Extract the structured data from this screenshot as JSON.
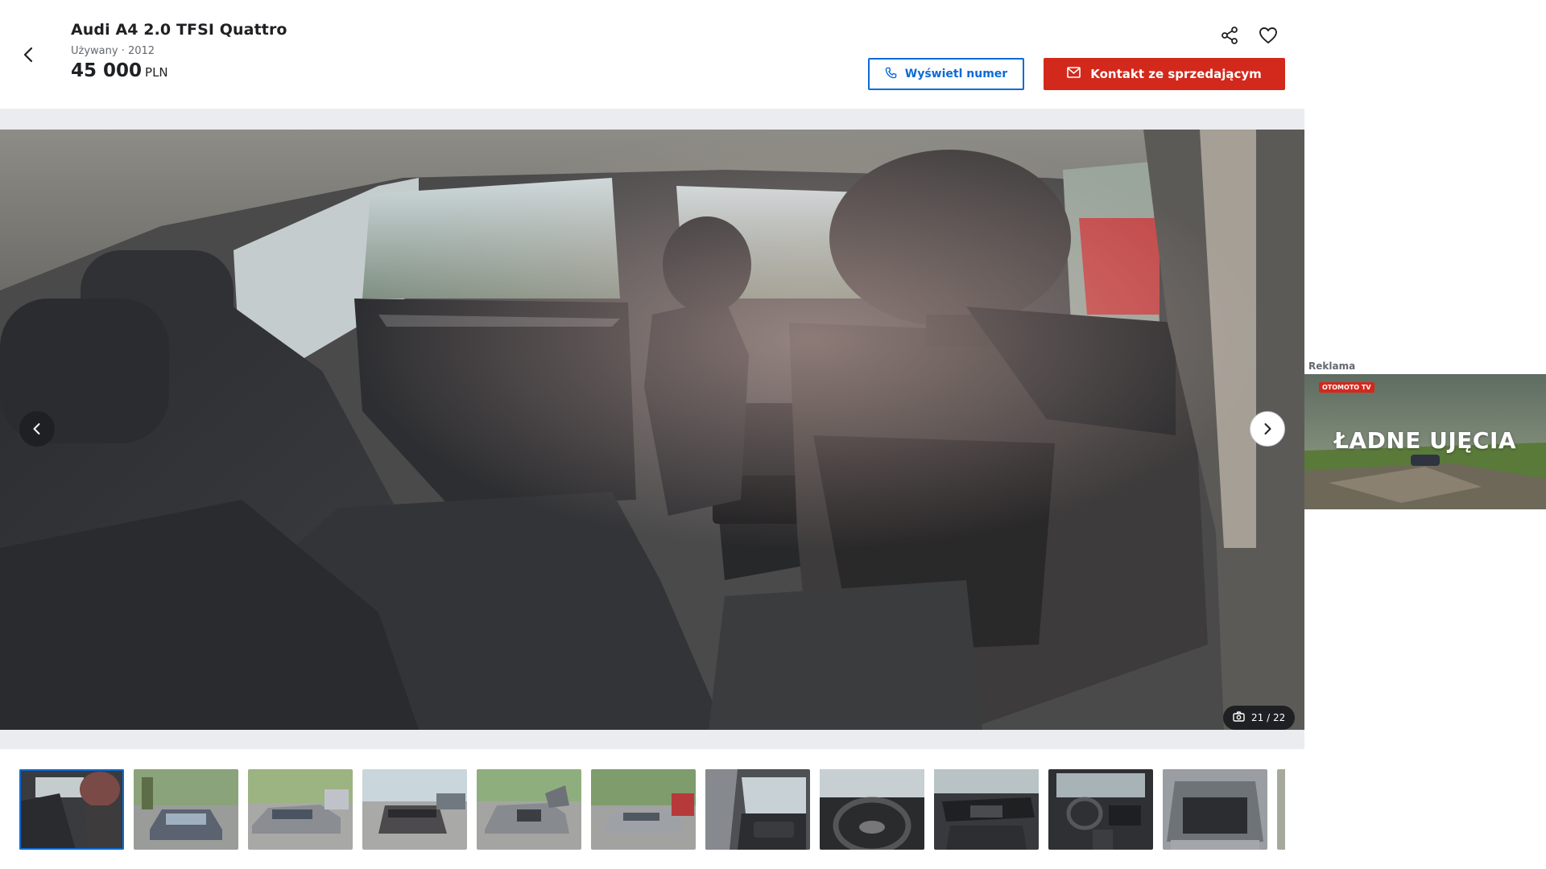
{
  "listing": {
    "title": "Audi A4 2.0 TFSI Quattro",
    "subtitle": "Używany · 2012",
    "price_value": "45 000",
    "price_currency": "PLN"
  },
  "actions": {
    "show_number": "Wyświetl numer",
    "contact_seller": "Kontakt ze sprzedającym"
  },
  "gallery": {
    "counter": "21 / 22",
    "current": 21,
    "total": 22,
    "thumbnail_count": 11
  },
  "ad": {
    "label": "Reklama",
    "logo": "OTOMOTO TV",
    "text": "ŁADNE UJĘCIA"
  },
  "colors": {
    "primary_blue": "#0d6ad6",
    "accent_red": "#d2291c",
    "text_dark": "#1f2023"
  },
  "icons": {
    "back": "chevron-left-icon",
    "share": "share-icon",
    "favorite": "heart-icon",
    "phone": "phone-icon",
    "mail": "mail-icon",
    "camera": "camera-icon"
  }
}
